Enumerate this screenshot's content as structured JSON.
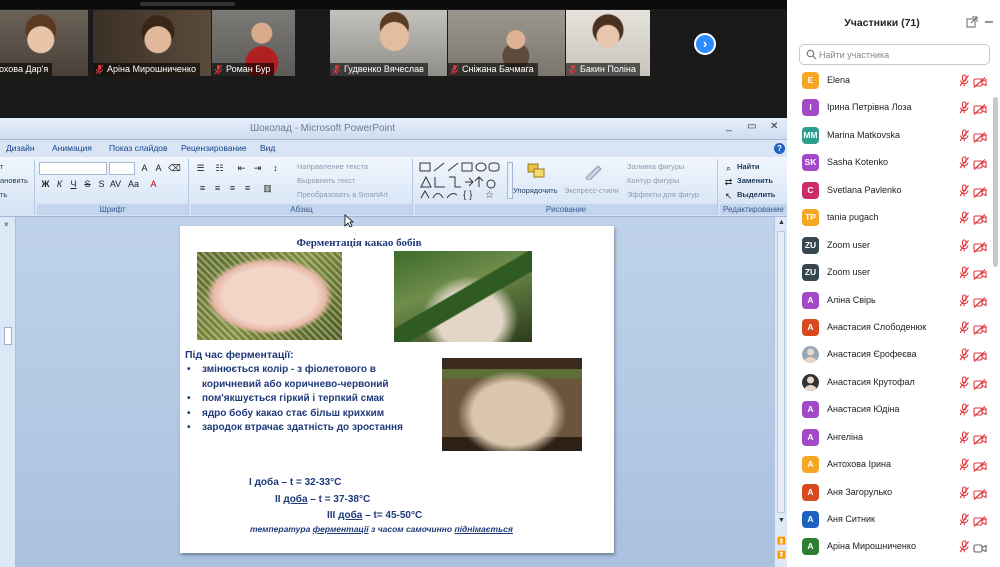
{
  "video_strip": {
    "tiles": [
      {
        "name": "Антохова Дар'я",
        "bg": "#5a5148"
      },
      {
        "name": "Аріна Мирошниченко",
        "bg": "#4a4036"
      },
      {
        "name": "Роман Бур",
        "bg": "#6c6a66"
      },
      {
        "name": "Гудвенко Вячеслав",
        "bg": "#a7a6a0"
      },
      {
        "name": "Сніжана Бачмага",
        "bg": "#8e8a82"
      },
      {
        "name": "Бакин Поліна",
        "bg": "#d8d5cf"
      }
    ],
    "next_icon": "chevron-right-icon"
  },
  "powerpoint": {
    "window_title": "Шоколад - Microsoft PowerPoint",
    "window_controls": [
      "_",
      "▭",
      "✕"
    ],
    "tabs": [
      "Дизайн",
      "Анимация",
      "Показ слайдов",
      "Рецензирование",
      "Вид"
    ],
    "ribbon": {
      "clip_items": [
        "т",
        "ановить",
        "ть"
      ],
      "groups": {
        "font": "Шрифт",
        "paragraph": "Абзац",
        "drawing": "Рисование",
        "editing": "Редактирование"
      },
      "paragraph_buttons": [
        "Направление текста",
        "Выровнять текст",
        "Преобразовать в SmartArt"
      ],
      "arrange_label": "Упорядочить",
      "quick_styles_label": "Экспресс-стили",
      "shape_buttons": [
        "Заливка фигуры",
        "Контур фигуры",
        "Эффекты для фигур"
      ],
      "editing_buttons": [
        "Найти",
        "Заменить",
        "Выделить"
      ]
    },
    "slide": {
      "title": "Ферментація какао бобів",
      "heading": "Під час ферментації:",
      "bullets": [
        "змінюється колір - з фіолетового в коричневий або коричнево-червоний",
        "пом'якшується гіркий і терпкий смак",
        "ядро бобу какао стає більш крихким",
        "зародок втрачає здатність до зростання"
      ],
      "days": [
        {
          "prefix": "І ",
          "word": "доба",
          "rest": " – t = 32-33°C"
        },
        {
          "prefix": "ІІ ",
          "word": "доба",
          "rest": " – t = 37-38°C"
        },
        {
          "prefix": "ІІІ ",
          "word": "доба",
          "rest": " – t= 45-50°C"
        }
      ],
      "note": {
        "a": "температура ",
        "b": "ферментації",
        "c": " з часом самочинно ",
        "d": "піднімається"
      }
    }
  },
  "participants": {
    "title": "Участники (71)",
    "search_placeholder": "Найти участника",
    "list": [
      {
        "initials": "E",
        "color": "#f5a623",
        "name": "Elena",
        "video": false
      },
      {
        "initials": "I",
        "color": "#a349c7",
        "name": "Ірина Петрівна Лоза",
        "video": false
      },
      {
        "initials": "MM",
        "color": "#2e9e8f",
        "name": "Marina Matkovska",
        "video": false
      },
      {
        "initials": "SK",
        "color": "#a349c7",
        "name": "Sasha Kotenko",
        "video": false
      },
      {
        "initials": "C",
        "color": "#cc2b6b",
        "name": "Svetlana Pavlenko",
        "video": false
      },
      {
        "initials": "TP",
        "color": "#f5a623",
        "name": "tania pugach",
        "video": false
      },
      {
        "initials": "ZU",
        "color": "#37474f",
        "name": "Zoom user",
        "video": false
      },
      {
        "initials": "ZU",
        "color": "#37474f",
        "name": "Zoom user",
        "video": false
      },
      {
        "initials": "A",
        "color": "#a349c7",
        "name": "Аліна Свірь",
        "video": false
      },
      {
        "initials": "A",
        "color": "#d84a1e",
        "name": "Анастасия Слободенюк",
        "video": false
      },
      {
        "initials": "",
        "color": "#9aa7b4",
        "name": "Анастасия Єрофеєва",
        "video": false
      },
      {
        "initials": "",
        "color": "#333333",
        "name": "Анастасия Крутофал",
        "video": false
      },
      {
        "initials": "A",
        "color": "#a349c7",
        "name": "Анастасия Юдіна",
        "video": false
      },
      {
        "initials": "A",
        "color": "#a349c7",
        "name": "Ангеліна",
        "video": false
      },
      {
        "initials": "A",
        "color": "#f5a623",
        "name": "Антохова Ірина",
        "video": false
      },
      {
        "initials": "A",
        "color": "#d84a1e",
        "name": "Аня Загорулько",
        "video": false
      },
      {
        "initials": "A",
        "color": "#1e62c2",
        "name": "Аня Ситник",
        "video": false
      },
      {
        "initials": "A",
        "color": "#2e7d32",
        "name": "Аріна Мирошниченко",
        "video": true
      }
    ]
  },
  "colors": {
    "accent": "#2d8cff",
    "muted_red": "#e0383e",
    "slide_text": "#1f3a7a"
  }
}
